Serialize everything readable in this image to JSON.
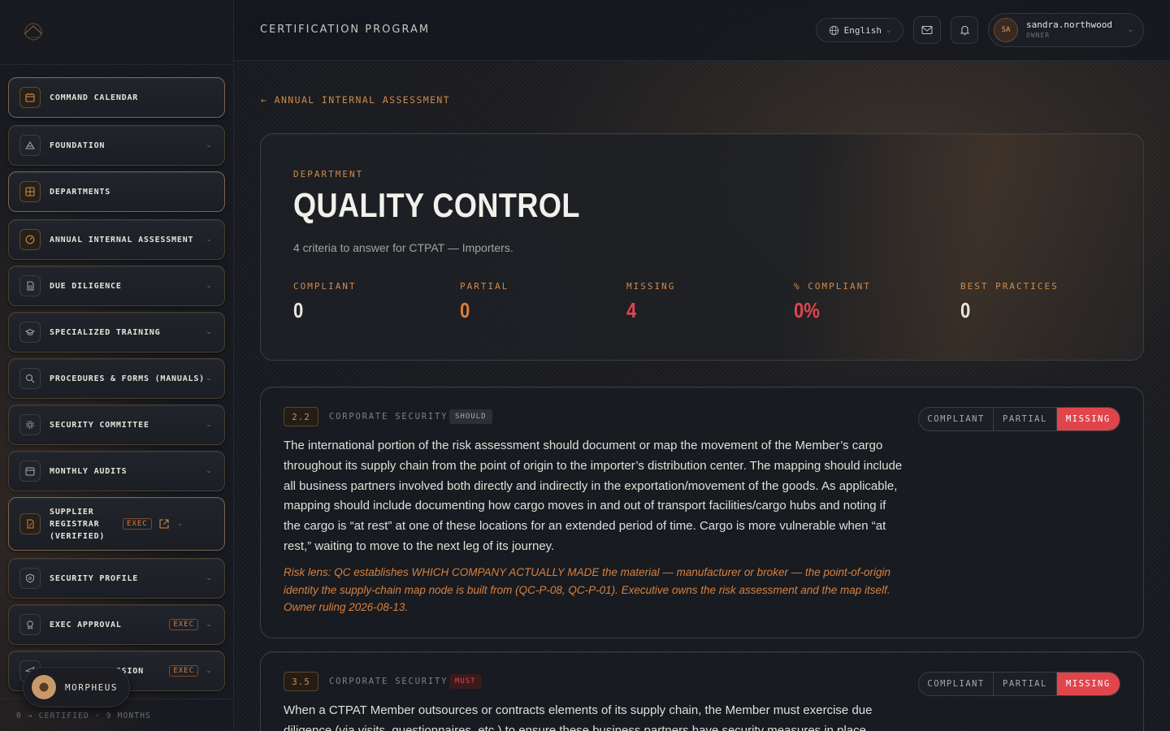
{
  "header": {
    "title": "CERTIFICATION PROGRAM",
    "language": "English",
    "user": {
      "initials": "SA",
      "name": "sandra.northwood",
      "role": "OWNER"
    }
  },
  "sidebar": {
    "items": [
      {
        "label": "COMMAND CALENDAR",
        "icon": "calendar-icon",
        "chevron": false
      },
      {
        "label": "FOUNDATION",
        "icon": "pyramid-icon",
        "chevron": true
      },
      {
        "label": "DEPARTMENTS",
        "icon": "grid-icon",
        "chevron": false
      },
      {
        "label": "ANNUAL INTERNAL ASSESSMENT",
        "icon": "gauge-icon",
        "chevron": true
      },
      {
        "label": "DUE DILIGENCE",
        "icon": "document-icon",
        "chevron": true
      },
      {
        "label": "SPECIALIZED TRAINING",
        "icon": "graduation-cap-icon",
        "chevron": true
      },
      {
        "label": "PROCEDURES & FORMS (MANUALS)",
        "icon": "magnifier-icon",
        "chevron": true
      },
      {
        "label": "SECURITY COMMITTEE",
        "icon": "gear-icon",
        "chevron": true
      },
      {
        "label": "MONTHLY AUDITS",
        "icon": "calendar-icon",
        "chevron": true
      },
      {
        "label": "SUPPLIER REGISTRAR (VERIFIED)",
        "icon": "file-edit-icon",
        "chevron": true,
        "badge": "EXEC"
      },
      {
        "label": "SECURITY PROFILE",
        "icon": "shield-icon",
        "chevron": true
      },
      {
        "label": "EXEC APPROVAL",
        "icon": "award-icon",
        "chevron": true,
        "badge": "EXEC"
      },
      {
        "label": "PORTAL SUBMISSION",
        "icon": "send-icon",
        "chevron": true,
        "badge": "EXEC"
      }
    ],
    "assistant": "MORPHEUS",
    "footer": "0 → CERTIFIED · 9 MONTHS"
  },
  "main": {
    "back_link": "← ANNUAL INTERNAL ASSESSMENT",
    "department": {
      "kicker": "DEPARTMENT",
      "title": "QUALITY CONTROL",
      "subtitle": "4 criteria to answer for CTPAT — Importers."
    },
    "stats": [
      {
        "label": "COMPLIANT",
        "value": "0",
        "color": "#e8e6e0"
      },
      {
        "label": "PARTIAL",
        "value": "0",
        "color": "#e07a3d"
      },
      {
        "label": "MISSING",
        "value": "4",
        "color": "#e0454c"
      },
      {
        "label": "% COMPLIANT",
        "value": "0%",
        "color": "#e0454c"
      },
      {
        "label": "BEST PRACTICES",
        "value": "0",
        "color": "#e8e6e0"
      }
    ],
    "criteria": [
      {
        "number": "2.2",
        "category": "CORPORATE SECURITY",
        "level": "SHOULD",
        "text": "The international portion of the risk assessment should document or map the movement of the Member’s cargo throughout its supply chain from the point of origin to the importer’s distribution center. The mapping should include all business partners involved both directly and indirectly in the exportation/movement of the goods. As applicable, mapping should include documenting how cargo moves in and out of transport facilities/cargo hubs and noting if the cargo is “at rest” at one of these locations for an extended period of time. Cargo is more vulnerable when “at rest,” waiting to move to the next leg of its journey.",
        "risk": "Risk lens: QC establishes WHICH COMPANY ACTUALLY MADE the material — manufacturer or broker — the point-of-origin identity the supply-chain map node is built from (QC-P-08, QC-P-01). Executive owns the risk assessment and the map itself. Owner ruling 2026-08-13.",
        "status_options": [
          "COMPLIANT",
          "PARTIAL",
          "MISSING"
        ],
        "status": "MISSING"
      },
      {
        "number": "3.5",
        "category": "CORPORATE SECURITY",
        "level": "MUST",
        "text": "When a CTPAT Member outsources or contracts elements of its supply chain, the Member must exercise due diligence (via visits, questionnaires, etc.) to ensure these business partners have security measures in place",
        "status_options": [
          "COMPLIANT",
          "PARTIAL",
          "MISSING"
        ],
        "status": "MISSING"
      }
    ]
  },
  "colors": {
    "accent": "#d08a4a",
    "missing": "#e0454c",
    "partial": "#e07a3d"
  }
}
